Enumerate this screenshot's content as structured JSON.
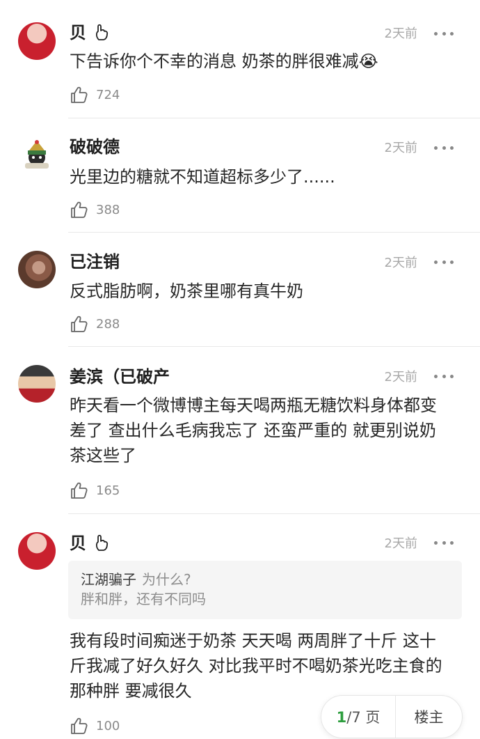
{
  "comments": [
    {
      "name": "贝",
      "name_icon": "hand-icon",
      "time": "2天前",
      "text": "下告诉你个不幸的消息 奶茶的胖很难减😭",
      "likes": "724",
      "avatar_colors": [
        "#c9202e",
        "#f3c9bf"
      ]
    },
    {
      "name": "破破德",
      "time": "2天前",
      "text": "光里边的糖就不知道超标多少了......",
      "likes": "388",
      "avatar_colors": [
        "#ffffff",
        "#2f6f36"
      ]
    },
    {
      "name": "已注销",
      "time": "2天前",
      "text": "反式脂肪啊，奶茶里哪有真牛奶",
      "likes": "288",
      "avatar_colors": [
        "#5b3a2c",
        "#c49a86"
      ]
    },
    {
      "name": "姜滨（已破产",
      "time": "2天前",
      "text": "昨天看一个微博博主每天喝两瓶无糖饮料身体都变差了 查出什么毛病我忘了 还蛮严重的 就更别说奶茶这些了",
      "likes": "165",
      "avatar_colors": [
        "#b5222a",
        "#e8c8a8"
      ]
    },
    {
      "name": "贝",
      "name_icon": "hand-icon",
      "time": "2天前",
      "quote": {
        "user": "江湖骗子",
        "text": "为什么?",
        "line2": "胖和胖，还有不同吗"
      },
      "text": "我有段时间痴迷于奶茶 天天喝 两周胖了十斤 这十斤我减了好久好久 对比我平时不喝奶茶光吃主食的那种胖 要减很久",
      "likes": "100",
      "avatar_colors": [
        "#c9202e",
        "#f3c9bf"
      ]
    }
  ],
  "pager": {
    "current": "1",
    "total": "/7 页",
    "op_label": "楼主",
    "accent": "#2e9e3f"
  }
}
